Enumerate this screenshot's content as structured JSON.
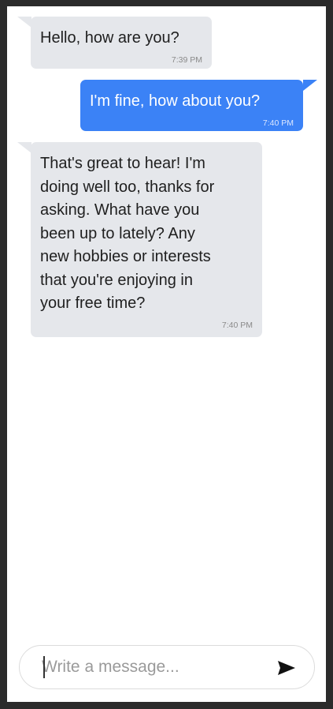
{
  "messages": [
    {
      "text": "Hello, how are you?",
      "time": "7:39 PM",
      "direction": "incoming"
    },
    {
      "text": "I'm fine, how about you?",
      "time": "7:40 PM",
      "direction": "outgoing"
    },
    {
      "text": "That's great to hear! I'm\ndoing well too, thanks for\nasking. What have you\nbeen up to lately? Any\nnew hobbies or interests\nthat you're enjoying in\nyour free time?",
      "time": "7:40 PM",
      "direction": "incoming"
    }
  ],
  "composer": {
    "placeholder": "Write a message...",
    "value": ""
  },
  "icons": {
    "send": "send-icon"
  },
  "colors": {
    "incoming_bubble": "#e5e7eb",
    "outgoing_bubble": "#3b82f6",
    "frame": "#2b2b2b"
  }
}
